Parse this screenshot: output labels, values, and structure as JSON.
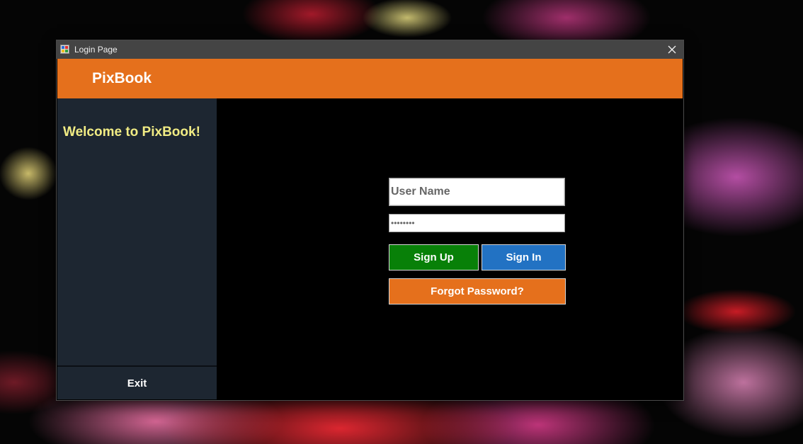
{
  "window": {
    "title": "Login Page",
    "icons": {
      "app": "app-window-icon",
      "close": "close-icon"
    }
  },
  "header": {
    "brand": "PixBook",
    "color": "#e5701c"
  },
  "sidebar": {
    "welcome": "Welcome to PixBook!",
    "exit_label": "Exit",
    "color": "#1d2631"
  },
  "form": {
    "username_placeholder": "User Name",
    "username_value": "",
    "password_value": "********",
    "signup_label": "Sign Up",
    "signin_label": "Sign In",
    "forgot_label": "Forgot Password?",
    "colors": {
      "signup": "#088008",
      "signin": "#2272c3",
      "forgot": "#e5701c"
    }
  }
}
